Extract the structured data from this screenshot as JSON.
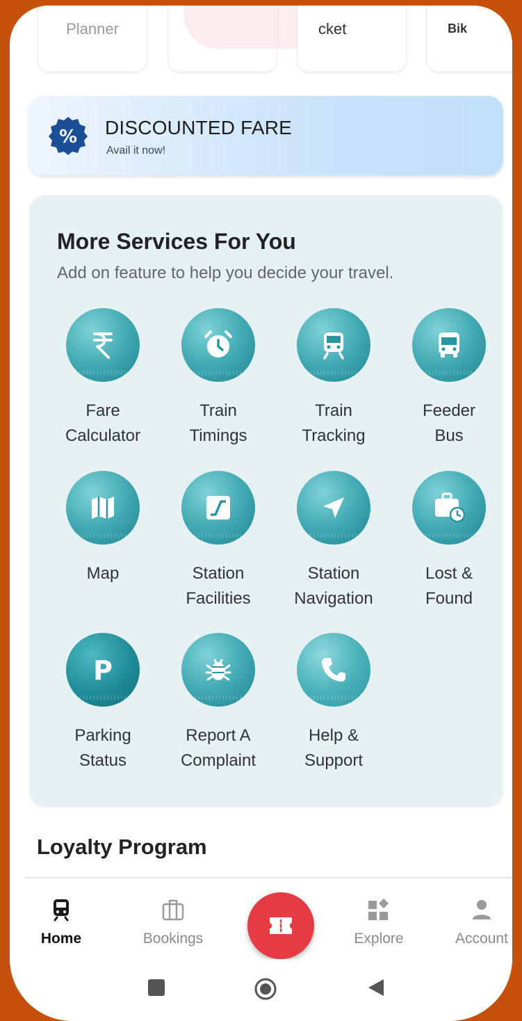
{
  "top_cards": [
    "Planner",
    "",
    "cket",
    "Bik"
  ],
  "discount": {
    "title": "DISCOUNTED FARE",
    "subtitle": "Avail it now!"
  },
  "services": {
    "heading": "More Services For You",
    "subheading": "Add on feature to help you decide your travel.",
    "items": [
      {
        "line1": "Fare",
        "line2": "Calculator",
        "icon": "rupee-icon"
      },
      {
        "line1": "Train",
        "line2": "Timings",
        "icon": "alarm-clock-icon"
      },
      {
        "line1": "Train",
        "line2": "Tracking",
        "icon": "train-icon"
      },
      {
        "line1": "Feeder",
        "line2": "Bus",
        "icon": "bus-icon"
      },
      {
        "line1": "Map",
        "line2": "",
        "icon": "map-icon"
      },
      {
        "line1": "Station",
        "line2": "Facilities",
        "icon": "stairs-icon"
      },
      {
        "line1": "Station",
        "line2": "Navigation",
        "icon": "navigation-arrow-icon"
      },
      {
        "line1": "Lost &",
        "line2": "Found",
        "icon": "suitcase-clock-icon"
      },
      {
        "line1": "Parking",
        "line2": "Status",
        "icon": "parking-icon"
      },
      {
        "line1": "Report A",
        "line2": "Complaint",
        "icon": "bug-icon"
      },
      {
        "line1": "Help &",
        "line2": "Support",
        "icon": "phone-icon"
      }
    ]
  },
  "loyalty": {
    "title": "Loyalty Program"
  },
  "nav": {
    "home": "Home",
    "bookings": "Bookings",
    "explore": "Explore",
    "account": "Account",
    "active": "home"
  },
  "colors": {
    "accent_teal": "#2a95a0",
    "fab_red": "#e53c45",
    "discount_badge": "#1c4f96",
    "background_frame": "#c4500c"
  }
}
